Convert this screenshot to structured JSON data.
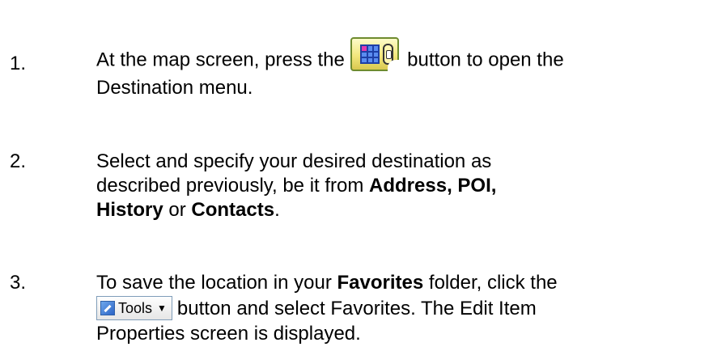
{
  "steps": [
    {
      "number": "1.",
      "line1_before": "At the map screen, press the ",
      "line1_after": " button to open the",
      "line2": "Destination menu."
    },
    {
      "number": "2.",
      "line1": "Select and specify your desired destination as",
      "line2_plain": "described previously, be it from ",
      "line2_bold": "Address, POI,",
      "line3_bold_a": "History",
      "line3_plain": " or ",
      "line3_bold_b": "Contacts",
      "line3_end": "."
    },
    {
      "number": "3.",
      "line1_plain": "To save the location in your ",
      "line1_bold": "Favorites",
      "line1_end": " folder, click the",
      "tools_label": "Tools",
      "line2_after": "button and select Favorites.  The Edit Item",
      "line3": "Properties screen is displayed."
    }
  ],
  "icons": {
    "destination_button": "destination-menu-icon",
    "tools_button": "tools-icon",
    "caret": "▼"
  }
}
